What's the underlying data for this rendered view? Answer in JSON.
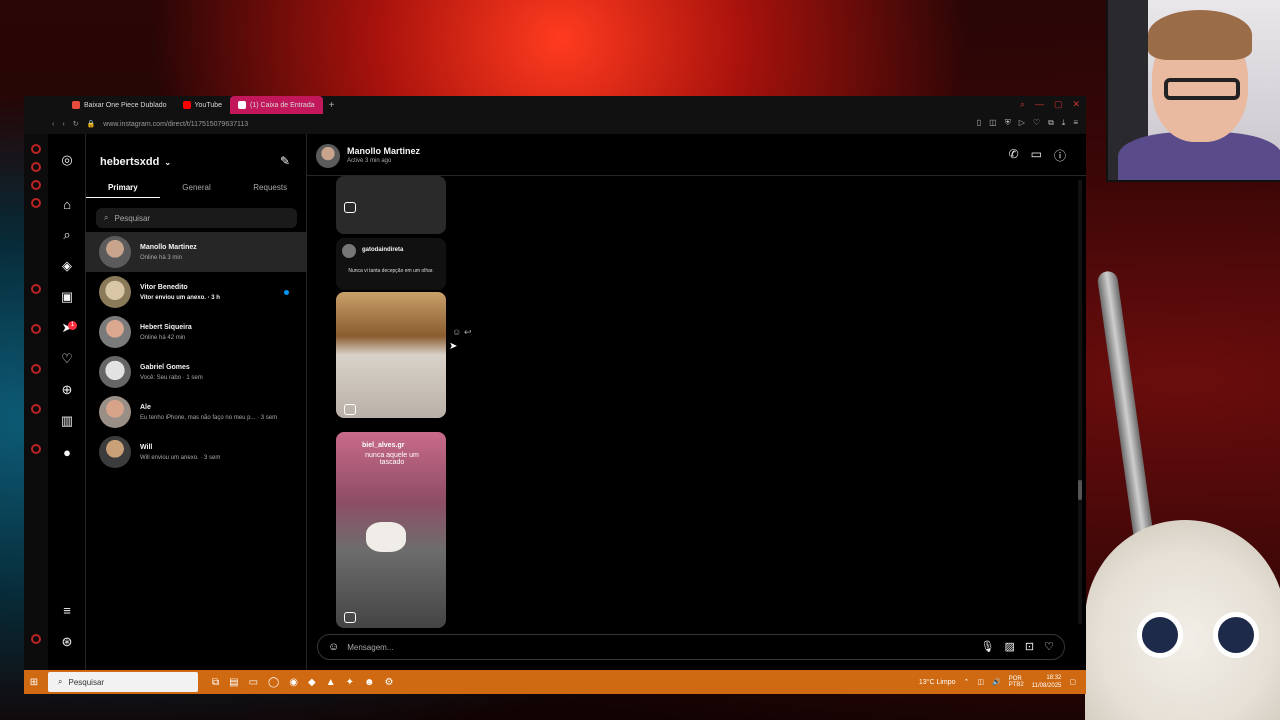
{
  "browser": {
    "tabs": [
      {
        "label": "Baixar One Piece Dublado",
        "color": "#e74c3c"
      },
      {
        "label": "YouTube",
        "color": "#ff0000"
      },
      {
        "label": "(1) Caixa de Entrada",
        "color": "#e1306c"
      }
    ],
    "new_tab": "+",
    "url": "www.instagram.com/direct/t/117515079637113"
  },
  "dm": {
    "username": "hebertsxdd",
    "tabs": [
      "Primary",
      "General",
      "Requests"
    ],
    "search_placeholder": "Pesquisar",
    "conversations": [
      {
        "name": "Manollo Martinez",
        "subtitle": "Online há 3 min",
        "selected": true
      },
      {
        "name": "Vitor Benedito",
        "subtitle": "Vitor enviou um anexo. · 3 h",
        "unread": true
      },
      {
        "name": "Hebert Siqueira",
        "subtitle": "Online há 42 min"
      },
      {
        "name": "Gabriel Gomes",
        "subtitle": "Você: Seu rabo · 1 sem"
      },
      {
        "name": "Ale",
        "subtitle": "Eu tenho iPhone, mas não faço no meu p... · 3 sem"
      },
      {
        "name": "Will",
        "subtitle": "Will enviou um anexo. · 3 sem"
      }
    ]
  },
  "chat": {
    "contact_name": "Manollo Martinez",
    "status": "Active 3 min ago",
    "messages": {
      "reel1_user": "gatodaindireta",
      "reel1_caption": "Nunca vi tanta decepção em um olhar.",
      "reel3_user": "biel_alves.gr",
      "reel3_caption": "nunca aquele um tascado"
    },
    "composer_placeholder": "Mensagem..."
  },
  "taskbar": {
    "search_placeholder": "Pesquisar",
    "weather": "13°C  Limpo",
    "lang": "POR\nPTB2",
    "time": "18:32",
    "date": "11/08/2025"
  }
}
